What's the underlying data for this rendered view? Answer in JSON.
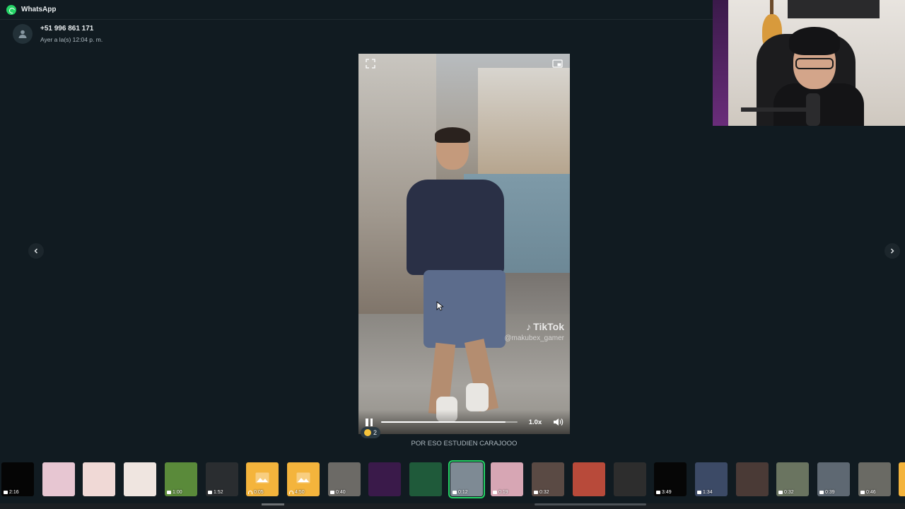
{
  "window": {
    "app_title": "WhatsApp"
  },
  "sender": {
    "name": "+51 996 861 171",
    "time": "Ayer a la(s) 12:04 p. m."
  },
  "video": {
    "watermark_brand": "TikTok",
    "watermark_handle": "@makubex_gamer",
    "speed_label": "1.0x",
    "progress": 0.91
  },
  "reaction": {
    "count": "2"
  },
  "caption": "POR ESO ESTUDIEN CARAJOOO",
  "thumbnails": [
    {
      "left": "",
      "duration": "2:16",
      "media": "video",
      "bg": "#050505"
    },
    {
      "duration": "",
      "media": "image",
      "bg": "#e7c6d2"
    },
    {
      "duration": "",
      "media": "image",
      "bg": "#f0d9d6"
    },
    {
      "duration": "",
      "media": "image",
      "bg": "#efe5e0"
    },
    {
      "duration": "1:00",
      "media": "video",
      "bg": "#5a8a3a"
    },
    {
      "duration": "1:52",
      "media": "video",
      "bg": "#2a2d30"
    },
    {
      "duration": "0:05",
      "media": "audio",
      "bg": "#f4b43c"
    },
    {
      "duration": "4:50",
      "media": "audio",
      "bg": "#f4b43c"
    },
    {
      "duration": "0:40",
      "media": "video",
      "bg": "#6c6a66"
    },
    {
      "duration": "",
      "media": "image",
      "bg": "#3a1a4a"
    },
    {
      "duration": "",
      "media": "image",
      "bg": "#1f5a3a"
    },
    {
      "duration": "0:12",
      "media": "video",
      "bg": "#7e8a94",
      "selected": true
    },
    {
      "duration": "0:19",
      "media": "video",
      "bg": "#d7a6b4"
    },
    {
      "duration": "0:32",
      "media": "video",
      "bg": "#5a4a44"
    },
    {
      "duration": "",
      "media": "image",
      "bg": "#b84a3a"
    },
    {
      "duration": "",
      "media": "image",
      "bg": "#2d2d2d"
    },
    {
      "duration": "3:49",
      "media": "video",
      "bg": "#060606"
    },
    {
      "duration": "1:34",
      "media": "video",
      "bg": "#3c4a66"
    },
    {
      "duration": "",
      "media": "image",
      "bg": "#4a3a36"
    },
    {
      "duration": "0:32",
      "media": "video",
      "bg": "#6a7460"
    },
    {
      "duration": "0:39",
      "media": "video",
      "bg": "#5e6872"
    },
    {
      "duration": "0:46",
      "media": "video",
      "bg": "#6a6a64"
    },
    {
      "duration": "",
      "media": "audio",
      "bg": "#f4b43c"
    }
  ],
  "colors": {
    "accent": "#25d366",
    "background": "#111b21"
  },
  "icons": [
    "whatsapp-logo-icon",
    "person-icon",
    "expand-icon",
    "picture-in-picture-icon",
    "pause-icon",
    "volume-icon",
    "chevron-left-icon",
    "chevron-right-icon",
    "video-camera-icon",
    "headphones-icon",
    "image-icon"
  ]
}
